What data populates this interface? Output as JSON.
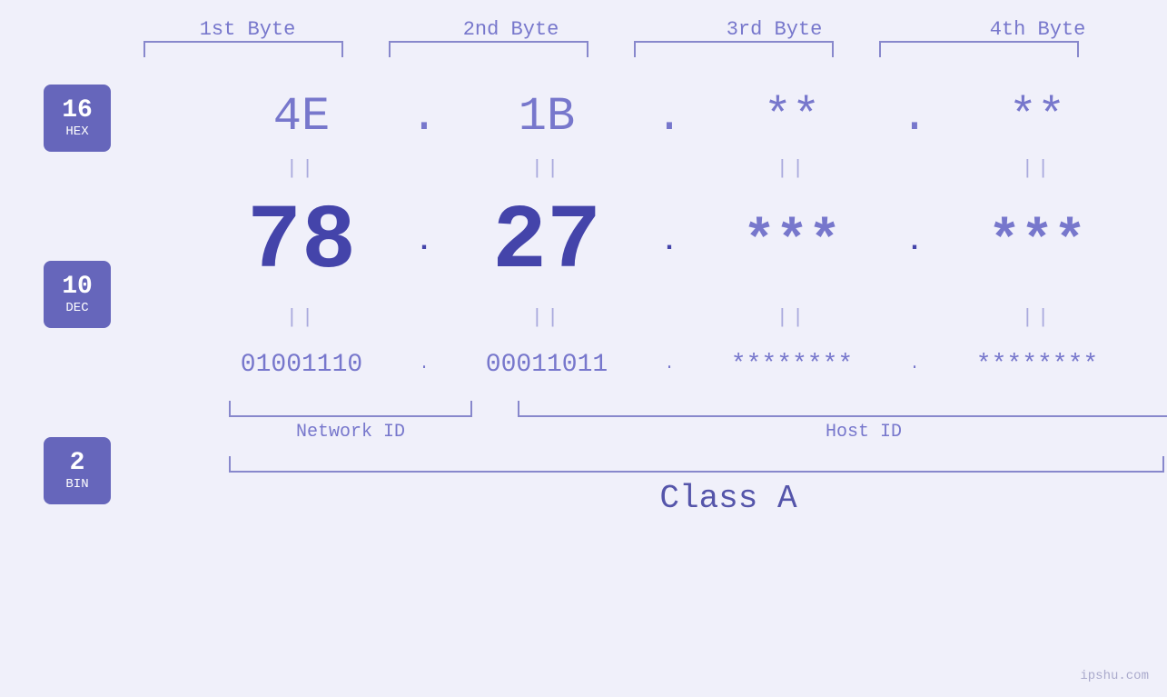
{
  "headers": {
    "byte1": "1st Byte",
    "byte2": "2nd Byte",
    "byte3": "3rd Byte",
    "byte4": "4th Byte"
  },
  "badges": {
    "hex": {
      "num": "16",
      "label": "HEX"
    },
    "dec": {
      "num": "10",
      "label": "DEC"
    },
    "bin": {
      "num": "2",
      "label": "BIN"
    }
  },
  "hex_row": {
    "b1": "4E",
    "dot1": ".",
    "b2": "1B",
    "dot2": ".",
    "b3": "**",
    "dot3": ".",
    "b4": "**"
  },
  "dec_row": {
    "b1": "78",
    "dot1": ".",
    "b2": "27",
    "dot2": ".",
    "b3": "***",
    "dot3": ".",
    "b4": "***"
  },
  "bin_row": {
    "b1": "01001110",
    "dot1": ".",
    "b2": "00011011",
    "dot2": ".",
    "b3": "********",
    "dot3": ".",
    "b4": "********"
  },
  "labels": {
    "network_id": "Network ID",
    "host_id": "Host ID",
    "class": "Class A"
  },
  "watermark": "ipshu.com"
}
